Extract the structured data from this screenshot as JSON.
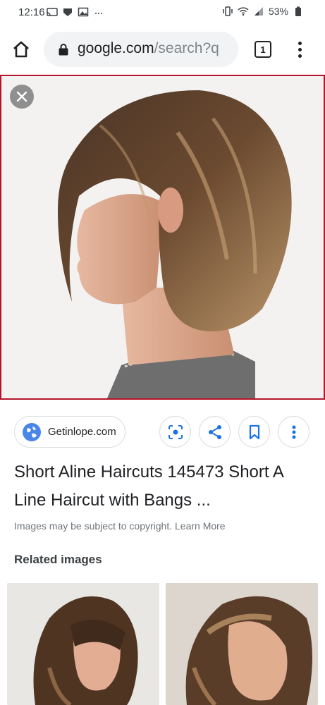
{
  "status_bar": {
    "time": "12:16",
    "battery": "53%",
    "icons": [
      "cast-icon",
      "app-notification-icon",
      "gallery-icon",
      "more-notifications-icon",
      "vibrate-icon",
      "wifi-icon",
      "signal-icon",
      "battery-icon"
    ]
  },
  "browser": {
    "url_domain": "google.com",
    "url_rest": "/search?q",
    "tab_count": "1"
  },
  "result": {
    "source": "Getinlope.com",
    "title": "Short Aline Haircuts 145473 Short A Line Haircut with Bangs ...",
    "copyright_text": "Images may be subject to copyright.",
    "learn_more": "Learn More"
  },
  "actions": [
    "lens-icon",
    "share-icon",
    "bookmark-icon",
    "more-options-icon"
  ],
  "related": {
    "heading": "Related images"
  },
  "colors": {
    "selected_border": "#b3152b",
    "accent_blue": "#1a73e8",
    "text_primary": "#202124",
    "text_secondary": "#70757a"
  }
}
